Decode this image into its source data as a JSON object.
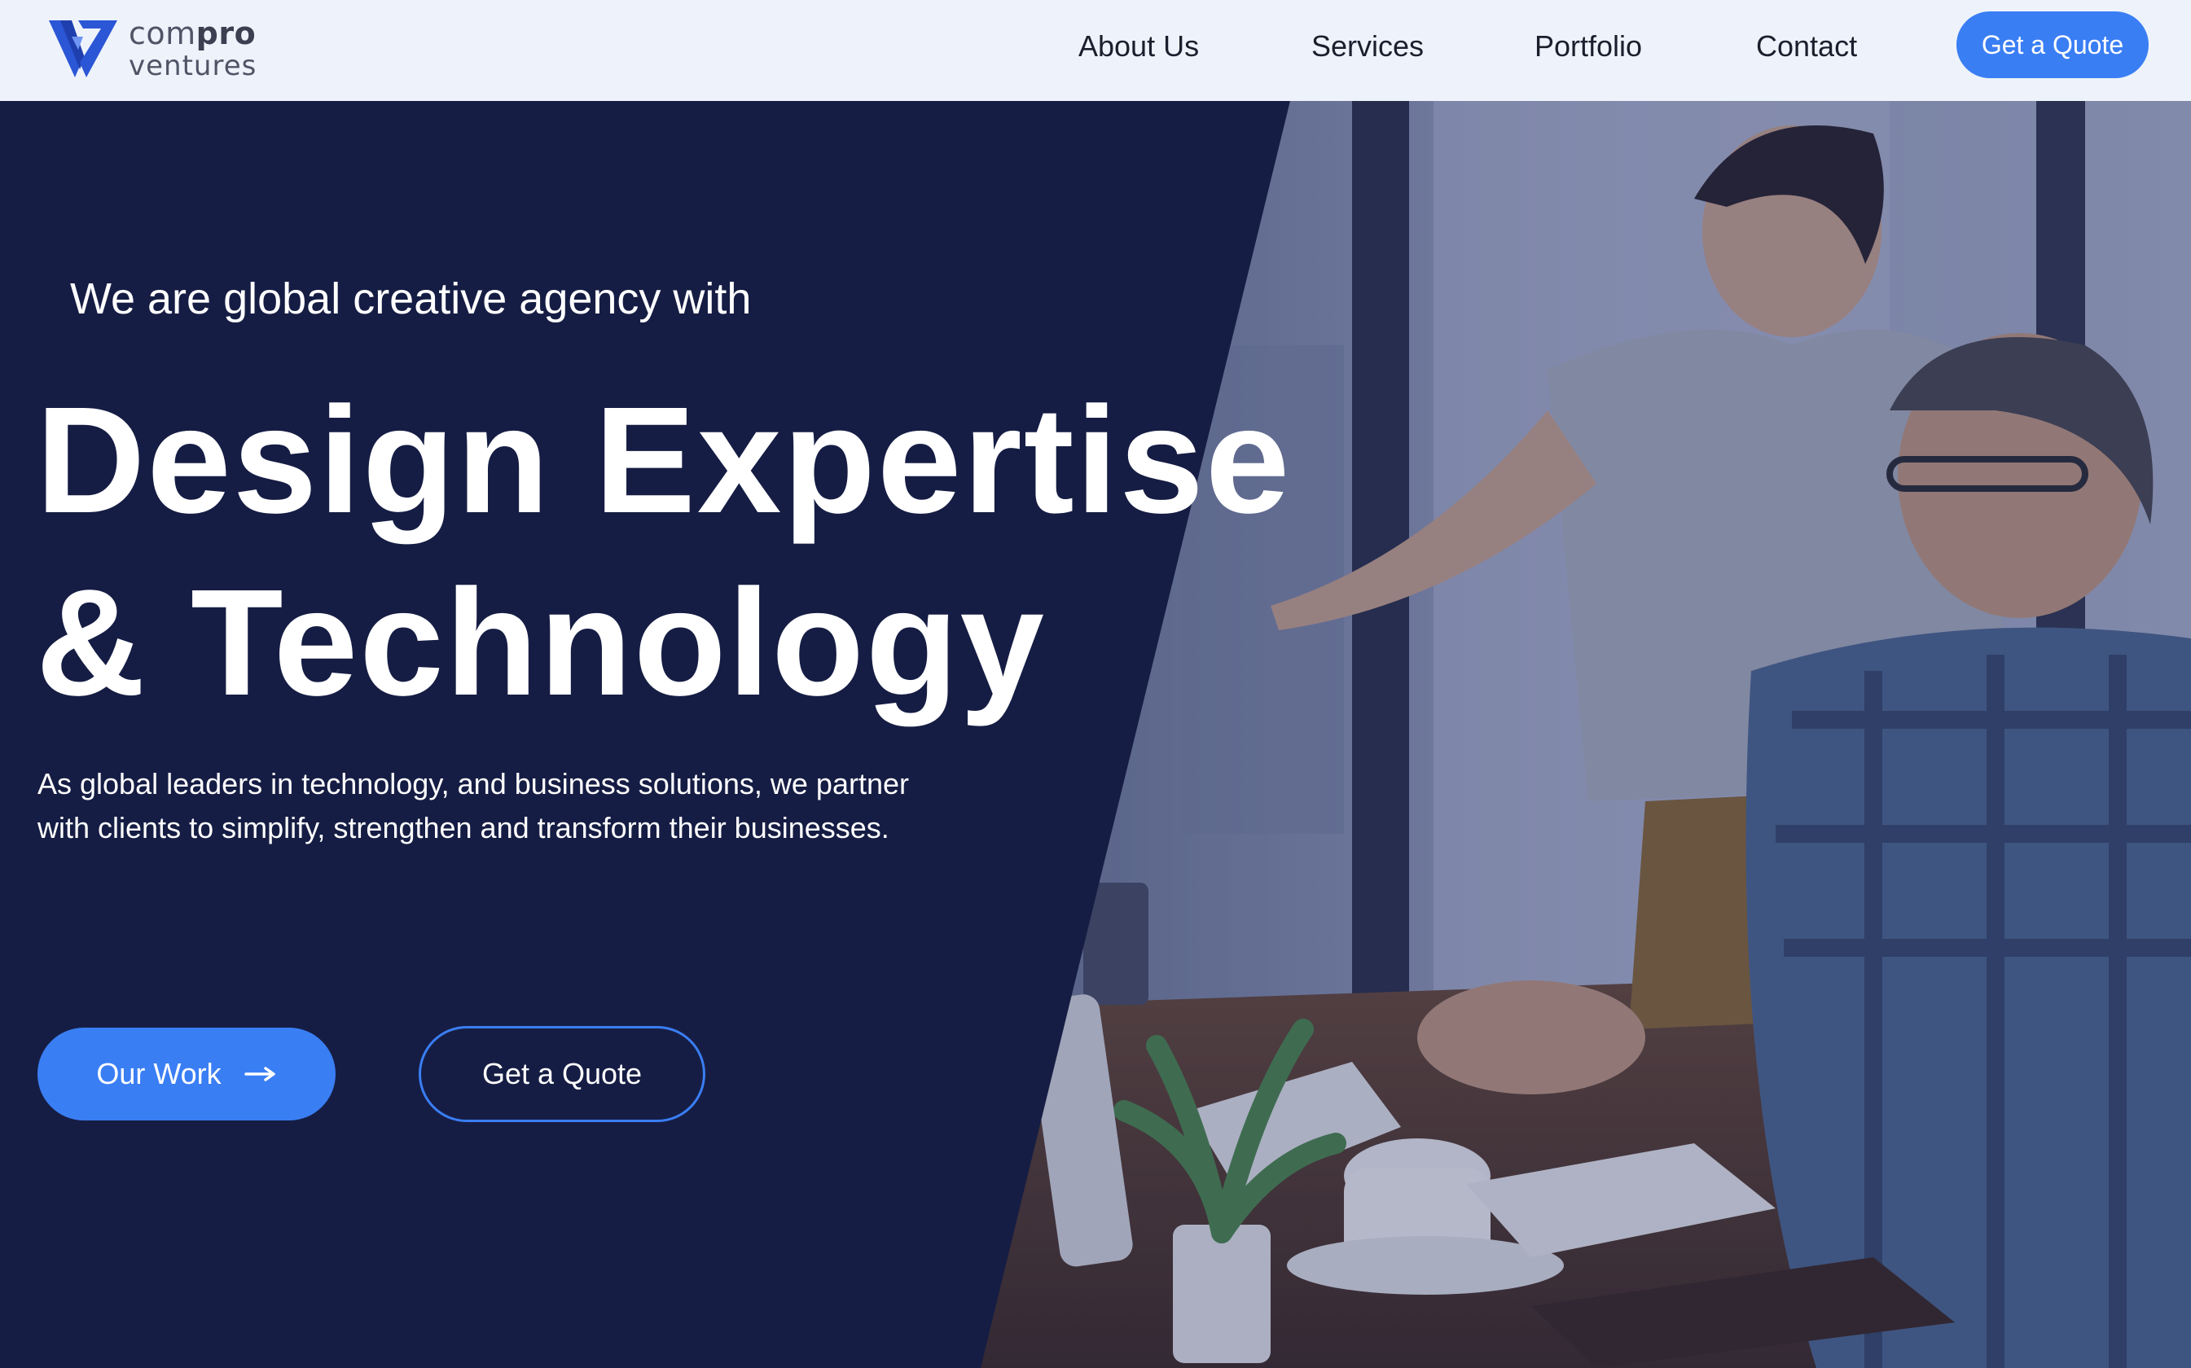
{
  "brand": {
    "logo_word_light": "com",
    "logo_word_bold": "pro",
    "logo_word_second": "ventures",
    "logo_icon": "cv-monogram-icon",
    "accent_color": "#3a7ef4",
    "logo_color": "#2b56d6"
  },
  "nav": {
    "items": [
      {
        "label": "About Us"
      },
      {
        "label": "Services"
      },
      {
        "label": "Portfolio"
      },
      {
        "label": "Contact"
      }
    ],
    "cta_label": "Get a Quote"
  },
  "hero": {
    "eyebrow": "We are global creative agency with",
    "headline_line1": "Design Expertise",
    "headline_line2": "& Technology",
    "lede": "As global leaders in technology, and business solutions, we partner with clients to simplify, strengthen and transform their businesses.",
    "primary_button": "Our Work",
    "primary_button_icon": "arrow-right-icon",
    "secondary_button": "Get a Quote",
    "background_color": "#161d44",
    "photo": "office-collaboration-photo"
  }
}
